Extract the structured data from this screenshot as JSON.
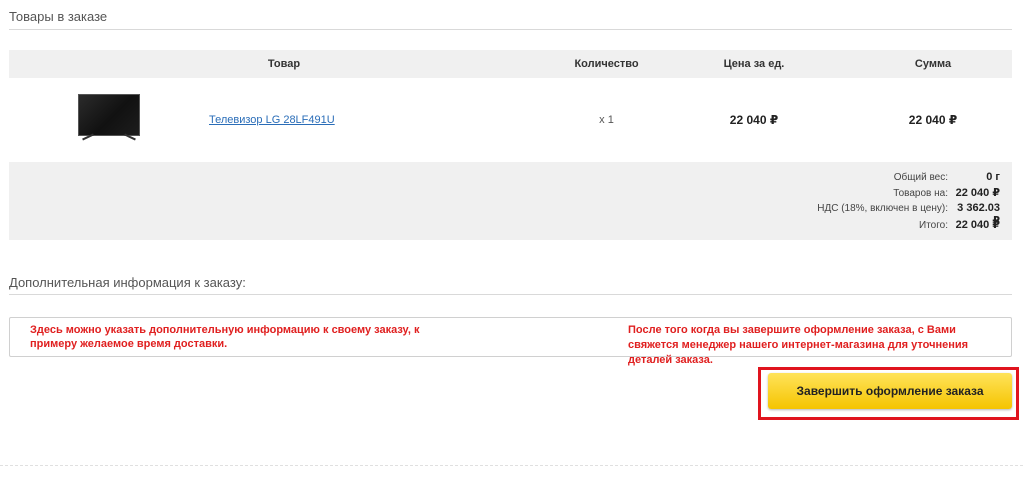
{
  "order_section": {
    "title": "Товары в заказе",
    "columns": {
      "product": "Товар",
      "quantity": "Количество",
      "unit_price": "Цена за ед.",
      "sum": "Сумма"
    },
    "items": [
      {
        "name": "Телевизор LG 28LF491U",
        "quantity": "x 1",
        "unit_price": "22 040 ₽",
        "sum": "22 040 ₽"
      }
    ],
    "totals": {
      "weight_label": "Общий вес:",
      "weight_value": "0 г",
      "goods_label": "Товаров на:",
      "goods_value": "22 040 ₽",
      "vat_label": "НДС (18%, включен в цену):",
      "vat_value": "3 362.03 ₽",
      "total_label": "Итого:",
      "total_value": "22 040 ₽"
    }
  },
  "additional_section": {
    "title": "Дополнительная информация к заказу:",
    "hint_left": "Здесь можно указать дополнительную информацию к своему заказу, к примеру желаемое время доставки.",
    "hint_right": "После того когда вы завершите оформление заказа, с Вами свяжется менеджер нашего интернет-магазина для уточнения деталей заказа."
  },
  "actions": {
    "finish_label": "Завершить оформление заказа"
  },
  "colors": {
    "accent_button": "#f5c400",
    "highlight_frame": "#e0141e",
    "annotation_text": "#e02020",
    "link": "#2a6db8"
  }
}
